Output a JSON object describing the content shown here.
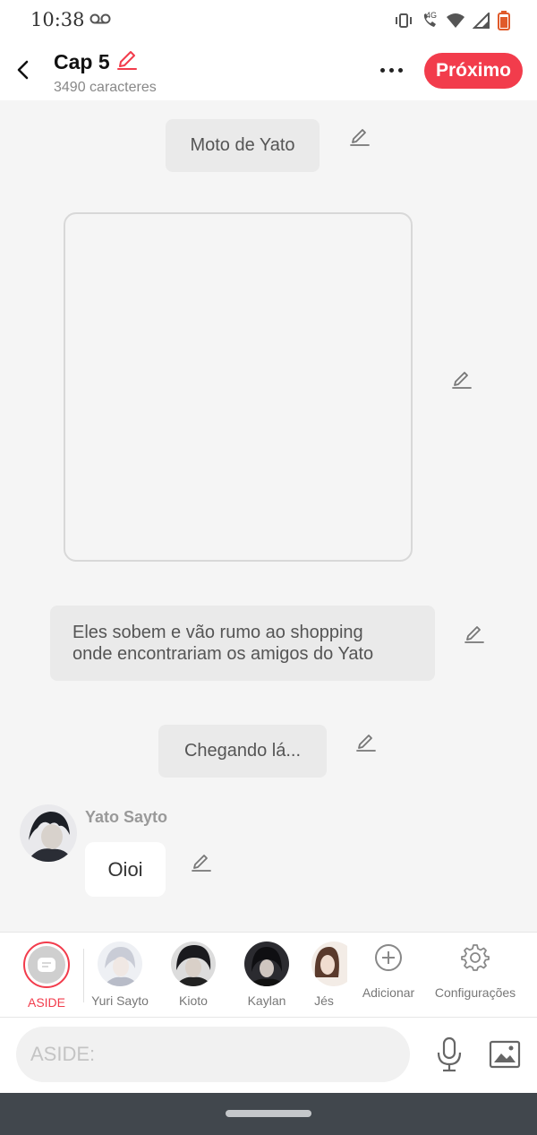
{
  "status_bar": {
    "time": "10:38",
    "network": "4G",
    "icons": [
      "voicemail-icon",
      "vibrate-icon",
      "wifi-calling-icon",
      "wifi-icon",
      "signal-icon",
      "battery-icon"
    ]
  },
  "header": {
    "title": "Cap 5",
    "subtitle": "3490 caracteres",
    "next_label": "Próximo"
  },
  "messages": {
    "narration_1": "Moto de Yato",
    "narration_2_line1": "Eles sobem e vão rumo ao shopping",
    "narration_2_line2": "onde encontrariam os amigos do Yato",
    "narration_3": "Chegando lá...",
    "character_name": "Yato Sayto",
    "character_message": "Oioi"
  },
  "character_bar": {
    "items": [
      {
        "label": "ASIDE"
      },
      {
        "label": "Yuri Sayto"
      },
      {
        "label": "Kioto"
      },
      {
        "label": "Kaylan"
      },
      {
        "label": "Jés"
      }
    ],
    "add_label": "Adicionar",
    "settings_label": "Configurações"
  },
  "input": {
    "placeholder": "ASIDE:"
  },
  "colors": {
    "accent": "#f23c4c",
    "bubble": "#eaeaea",
    "background": "#f5f5f5",
    "navbar": "#41474d"
  }
}
